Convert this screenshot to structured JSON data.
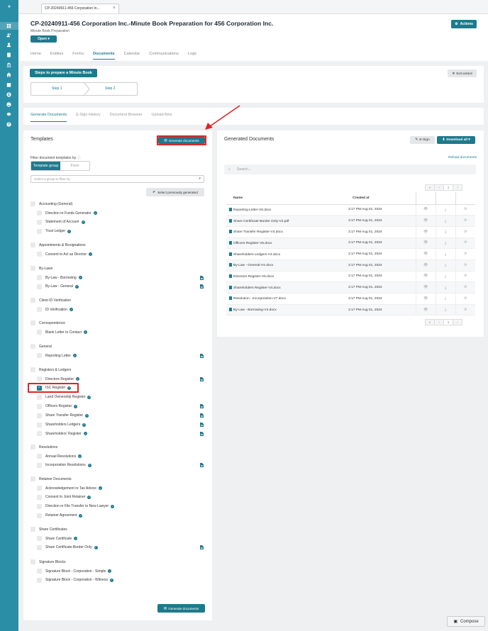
{
  "sidebar": {
    "expand_label": "»",
    "icons": [
      "dashboard-icon",
      "contacts-icon",
      "person-icon",
      "building-icon",
      "bank-icon",
      "home-icon",
      "calendar-icon",
      "user-circle-icon",
      "user-icon",
      "settings-icon",
      "help-icon"
    ]
  },
  "tab": {
    "label": "CP-20240911-456 Corporation In..."
  },
  "header": {
    "title": "CP-20240911-456 Corporation Inc.-Minute Book Preparation for 456 Corporation Inc.",
    "subtitle": "Minute Book Preparation",
    "open_label": "Open ▾",
    "actions_label": "Actions"
  },
  "main_tabs": [
    "Home",
    "Entities",
    "Forms",
    "Documents",
    "Calendar",
    "Communications",
    "Logs"
  ],
  "wizard": {
    "title": "Steps to prepare a Minute Book",
    "exit_label": "Exit wizard",
    "steps": [
      "Step 1",
      "Step 2"
    ]
  },
  "sub_tabs": [
    "Generate Documents",
    "E-Sign History",
    "Document Browser",
    "Upload Bins"
  ],
  "templates": {
    "title": "Templates",
    "generate_label": "Generate documents",
    "filter_label": "Filter document templates by",
    "toggle": [
      "Template group",
      "Form"
    ],
    "select_placeholder": "Select a group to filter by",
    "prev_label": "Select previously generated",
    "bottom_generate_label": "Generate documents",
    "groups": [
      {
        "name": "Accounting (General)",
        "items": [
          {
            "label": "Direction re Funds Generator",
            "doc": false
          },
          {
            "label": "Statement of Account",
            "doc": false
          },
          {
            "label": "Trust Ledger",
            "doc": false
          }
        ]
      },
      {
        "name": "Appointments & Resignations",
        "items": [
          {
            "label": "Consent to Act as Director",
            "doc": false
          }
        ]
      },
      {
        "name": "By-Laws",
        "items": [
          {
            "label": "By-Law - Borrowing",
            "doc": true
          },
          {
            "label": "By-Law - General",
            "doc": true
          }
        ]
      },
      {
        "name": "Client ID Verification",
        "items": [
          {
            "label": "ID Verification",
            "doc": false
          }
        ]
      },
      {
        "name": "Correspondence",
        "items": [
          {
            "label": "Blank Letter to Contact",
            "doc": false
          }
        ]
      },
      {
        "name": "General",
        "items": [
          {
            "label": "Reporting Letter",
            "doc": true
          }
        ]
      },
      {
        "name": "Registers & Ledgers",
        "items": [
          {
            "label": "Directors Register",
            "doc": true
          },
          {
            "label": "ISC Register",
            "doc": false,
            "checked": true
          },
          {
            "label": "Land Ownership Register",
            "doc": false
          },
          {
            "label": "Officers Register",
            "doc": true
          },
          {
            "label": "Share Transfer Register",
            "doc": true
          },
          {
            "label": "Shareholders Ledgers",
            "doc": true
          },
          {
            "label": "Shareholders' Register",
            "doc": true
          }
        ]
      },
      {
        "name": "Resolutions",
        "items": [
          {
            "label": "Annual Resolutions",
            "doc": false
          },
          {
            "label": "Incorporation Resolutions",
            "doc": true
          }
        ]
      },
      {
        "name": "Retainer Documents",
        "items": [
          {
            "label": "Acknowledgement re Tax Advice",
            "doc": false
          },
          {
            "label": "Consent to Joint Retainer",
            "doc": false
          },
          {
            "label": "Direction re File Transfer to New Lawyer",
            "doc": false
          },
          {
            "label": "Retainer Agreement",
            "doc": false
          }
        ]
      },
      {
        "name": "Share Certificates",
        "items": [
          {
            "label": "Share Certificate",
            "doc": false
          },
          {
            "label": "Share Certificate-Border Only",
            "doc": true
          }
        ]
      },
      {
        "name": "Signature Blocks",
        "items": [
          {
            "label": "Signature Block - Corporation - Simple",
            "doc": false
          },
          {
            "label": "Signature Block - Corporation - Witness",
            "doc": false
          }
        ]
      }
    ]
  },
  "generated": {
    "title": "Generated Documents",
    "esign_label": "E-Sign",
    "download_label": "Download all ▾",
    "reload_label": "Reload documents",
    "search_placeholder": "Search...",
    "pager": [
      "«",
      "‹",
      "1",
      "›"
    ],
    "columns": [
      "Name",
      "Created at"
    ],
    "rows": [
      {
        "name": "Reporting Letter-V6.docx",
        "created": "2:17 PM Aug 01, 2024"
      },
      {
        "name": "Share Certificate-Border Only-V2.pdf",
        "created": "2:17 PM Aug 01, 2024"
      },
      {
        "name": "Share Transfer Register-V4.docx",
        "created": "2:17 PM Aug 01, 2024"
      },
      {
        "name": "Officers Register-V5.docx",
        "created": "2:17 PM Aug 01, 2024"
      },
      {
        "name": "Shareholders Ledgers-V4.docx",
        "created": "2:17 PM Aug 01, 2024"
      },
      {
        "name": "By-Law - General-V4.docx",
        "created": "2:17 PM Aug 01, 2024"
      },
      {
        "name": "Directors Register-V5.docx",
        "created": "2:17 PM Aug 01, 2024"
      },
      {
        "name": "Shareholders Register-V4.docx",
        "created": "2:17 PM Aug 01, 2024"
      },
      {
        "name": "Resolution - Incorporation-V7.docx",
        "created": "2:17 PM Aug 01, 2024"
      },
      {
        "name": "By-Law - Borrowing-V4.docx",
        "created": "2:17 PM Aug 01, 2024"
      }
    ]
  },
  "compose_label": "Compose",
  "colors": {
    "sidebar": "#2a8ea6",
    "primary": "#1d7a8c",
    "highlight": "#e02424"
  }
}
